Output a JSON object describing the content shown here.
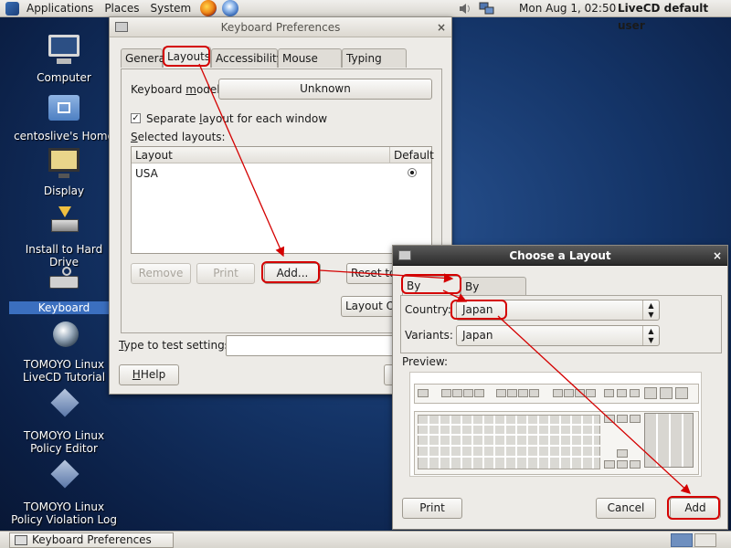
{
  "top_panel": {
    "applications": "Applications",
    "places": "Places",
    "system": "System",
    "clock": "Mon Aug  1, 02:50",
    "user": "LiveCD default user"
  },
  "desktop_icons": [
    {
      "label": "Computer"
    },
    {
      "label": "centoslive's Home"
    },
    {
      "label": "Display"
    },
    {
      "label": "Install to Hard Drive"
    },
    {
      "label": "Keyboard"
    },
    {
      "label": "TOMOYO Linux\nLiveCD Tutorial"
    },
    {
      "label": "TOMOYO Linux\nPolicy Editor"
    },
    {
      "label": "TOMOYO Linux\nPolicy Violation Log"
    }
  ],
  "taskbar": {
    "item": "Keyboard Preferences"
  },
  "prefs": {
    "title": "Keyboard Preferences",
    "tabs": [
      "General",
      "Layouts",
      "Accessibility",
      "Mouse Keys",
      "Typing Break"
    ],
    "model_label_pre": "Keyboard ",
    "model_label_u": "m",
    "model_label_post": "odel:",
    "model_value": "Unknown",
    "separate_pre": "Separate ",
    "separate_u": "l",
    "separate_post": "ayout for each window",
    "selected_u": "S",
    "selected_post": "elected layouts:",
    "col_layout": "Layout",
    "col_default": "Default",
    "row_layout": "USA",
    "remove": "Remove",
    "print": "Print",
    "add": "Add...",
    "reset": "Reset to D",
    "layout_options": "Layout Op",
    "test_u": "T",
    "test_post": "ype to test settings:",
    "help": "Help"
  },
  "chooser": {
    "title": "Choose a Layout",
    "tab_country": "By country",
    "tab_language": "By language",
    "country_label": "Country:",
    "country_value": "Japan",
    "variants_label": "Variants:",
    "variants_value": "Japan",
    "preview_label": "Preview:",
    "print": "Print",
    "cancel": "Cancel",
    "add": "Add"
  }
}
